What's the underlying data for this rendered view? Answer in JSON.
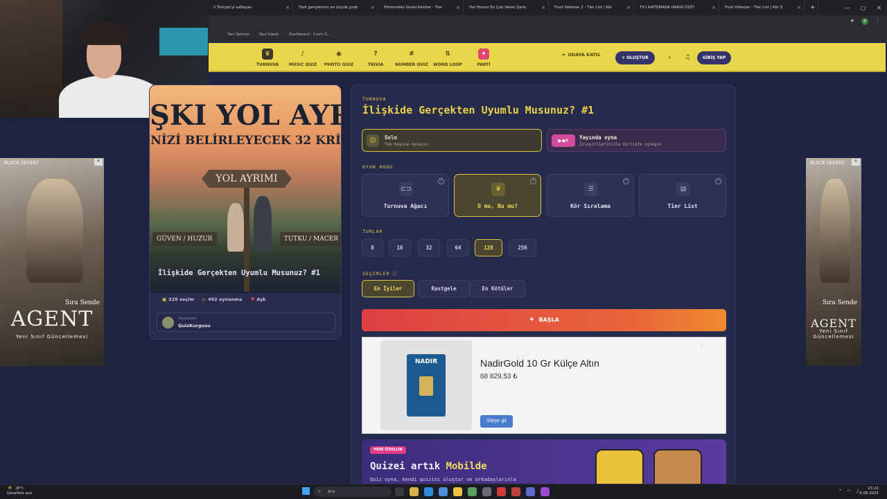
{
  "browser": {
    "tabs": [
      "il Türkiye'yi sallayan",
      "Türk gençlerinin en büyük prob",
      "Filmlerdeki Güzel Katiller - Tier",
      "Yaz Hissini En Çok Veren Şarkı",
      "Fosil Videolar 2 - Tier List | Kör",
      "TV'i KAFİSMADA HANGİ DİZİ?",
      "Fosil Videolar - Tier List | Kör S"
    ],
    "new_tab": "+",
    "bookmarks": [
      "Yeni Sekme",
      "Yeni klasör",
      "Dashboard - Castr S..."
    ],
    "profile_initial": "P"
  },
  "nav": {
    "items": [
      {
        "label": "TURNUVA",
        "icon": "♛"
      },
      {
        "label": "MUSIC QUIZ",
        "icon": "♪"
      },
      {
        "label": "PHOTO QUIZ",
        "icon": "◉"
      },
      {
        "label": "TRIVIA",
        "icon": "?"
      },
      {
        "label": "NUMBER QUIZ",
        "icon": "#"
      },
      {
        "label": "WORD LOOP",
        "icon": "⇅"
      },
      {
        "label": "PARTİ",
        "icon": "✦"
      }
    ],
    "join": "ODAYA KATIL",
    "create": "+ OLUŞTUR",
    "login": "GİRİŞ YAP"
  },
  "left_card": {
    "cover_line1": "ŞKI YOL AYRI",
    "cover_line2": "NİZİ BELİRLEYECEK 32 KRİ",
    "cover_sign": "YOL AYRIMI",
    "cover_label_left": "GÜVEN / HUZUR",
    "cover_label_right": "TUTKU / MACER",
    "title": "İlişkide Gerçekten Uyumlu Musunuz? #1",
    "choices": "226 seçim",
    "plays": "492 oynanma",
    "category": "Aşk",
    "creator_label": "Oluşturan",
    "creator_name": "QuizKurgusu"
  },
  "panel": {
    "kicker": "TURNUVA",
    "title": "İlişkide Gerçekten Uyumlu Musunuz? #1",
    "solo_title": "Solo",
    "solo_sub": "Tek başına oynayın",
    "stream_title": "Yayında oyna",
    "stream_sub": "İzleyicilerinizle birlikte oynayın",
    "game_mode_label": "OYUN MODU",
    "modes": [
      "Turnuva Ağacı",
      "O mu, Bu mu?",
      "Kör Sıralama",
      "Tier List"
    ],
    "rounds_label": "TURLAR",
    "rounds": [
      "8",
      "16",
      "32",
      "64",
      "128",
      "256"
    ],
    "choices_label": "SEÇİMLER",
    "choices": [
      "En İyiler",
      "Rastgele",
      "En Kötüler"
    ],
    "start": "BAŞLA"
  },
  "product_ad": {
    "brand": "NADIR",
    "title": "NadirGold 10 Gr Külçe Altın",
    "price": "68 829,53 ₺",
    "cta": "Siteye git"
  },
  "promo": {
    "tag": "YENİ ÖZELLİK",
    "title_pre": "Quizei artık ",
    "title_hl": "Mobilde",
    "sub": "Quiz oyna, kendi quizini oluştur ve arkadaşlarınla"
  },
  "side_ads": {
    "brand": "BLACK DESERT",
    "sira": "Sıra Sende",
    "title": "AGENT",
    "sub": "Yeni Sınıf Güncellemesi"
  },
  "taskbar": {
    "temp": "28°C",
    "weather": "Genellikle açık",
    "search": "Ara",
    "time": "23:22",
    "date": "9.08.2025"
  }
}
